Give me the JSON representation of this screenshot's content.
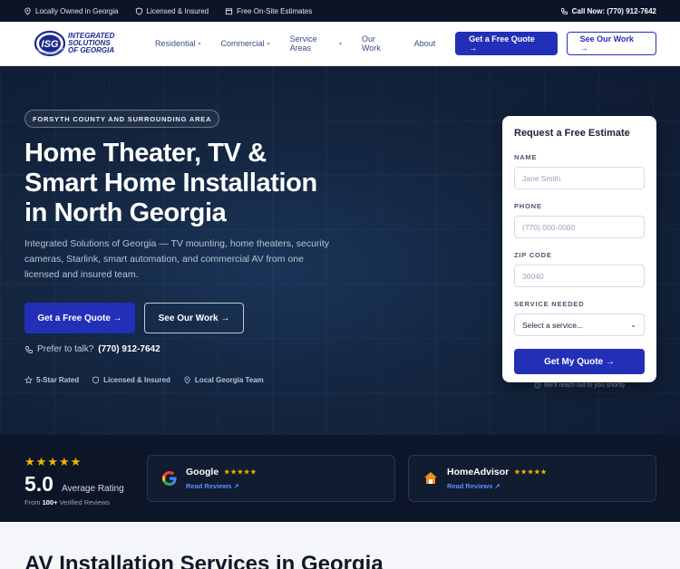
{
  "topbar": {
    "owned": "Locally Owned in Georgia",
    "licensed": "Licensed & Insured",
    "estimates": "Free On-Site Estimates",
    "call": "Call Now: (770) 912-7642"
  },
  "logo": {
    "line1": "Integrated",
    "line2": "Solutions",
    "line3": "of Georgia",
    "mark": "ISG"
  },
  "nav": {
    "items": [
      {
        "label": "Residential",
        "dropdown": true
      },
      {
        "label": "Commercial",
        "dropdown": true
      },
      {
        "label": "Service Areas",
        "dropdown": true
      },
      {
        "label": "Our Work",
        "dropdown": false
      },
      {
        "label": "About",
        "dropdown": false
      }
    ],
    "quote_button": "Get a Free Quote →",
    "work_button": "See Our Work →"
  },
  "hero": {
    "badge": "FORSYTH COUNTY AND SURROUNDING AREA",
    "title_line1": "Home Theater, TV &",
    "title_line2": "Smart Home Installation",
    "title_line3": "in North Georgia",
    "subtitle": "Integrated Solutions of Georgia — TV mounting, home theaters, security cameras, Starlink, smart automation, and commercial AV from one licensed and insured team.",
    "quote_button": "Get a Free Quote →",
    "work_button": "See Our Work →",
    "talk_label": "Prefer to talk?",
    "talk_phone": "(770) 912-7642",
    "trust": [
      "5-Star Rated",
      "Licensed & Insured",
      "Local Georgia Team"
    ]
  },
  "form": {
    "title": "Request a Free Estimate",
    "name_label": "NAME",
    "name_placeholder": "Jane Smith",
    "phone_label": "PHONE",
    "phone_placeholder": "(770) 000-0000",
    "zip_label": "ZIP CODE",
    "zip_placeholder": "30040",
    "service_label": "SERVICE NEEDED",
    "service_value": "Select a service...",
    "submit": "Get My Quote →",
    "note": "We'll reach out to you shortly"
  },
  "reviews": {
    "stars": "★★★★★",
    "rating": "5.0",
    "rating_label": "Average Rating",
    "from_prefix": "From",
    "from_count": "100+",
    "from_suffix": "Verified Reviews",
    "google": {
      "name": "Google",
      "stars": "★★★★★",
      "link": "Read Reviews ↗"
    },
    "homeadvisor": {
      "name": "HomeAdvisor",
      "stars": "★★★★★",
      "link": "Read Reviews ↗"
    }
  },
  "services": {
    "heading": "AV Installation Services in Georgia"
  },
  "colors": {
    "primary": "#2230b8",
    "dark": "#0d1628",
    "star": "#f5b301",
    "link": "#5b8dff"
  }
}
